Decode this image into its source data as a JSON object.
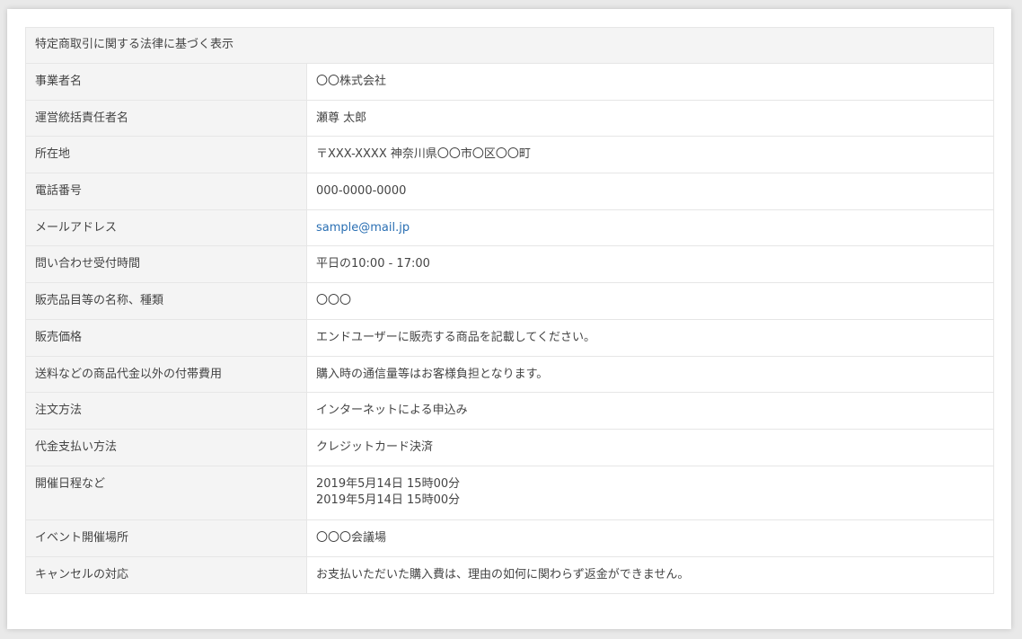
{
  "table": {
    "heading": "特定商取引に関する法律に基づく表示",
    "rows": [
      {
        "label": "事業者名",
        "value": "〇〇株式会社"
      },
      {
        "label": "運営統括責任者名",
        "value": "瀬尊 太郎"
      },
      {
        "label": "所在地",
        "value": "〒XXX-XXXX 神奈川県〇〇市〇区〇〇町"
      },
      {
        "label": "電話番号",
        "value": "000-0000-0000"
      },
      {
        "label": "メールアドレス",
        "value": "sample@mail.jp"
      },
      {
        "label": "問い合わせ受付時間",
        "value": "平日の10:00 - 17:00"
      },
      {
        "label": "販売品目等の名称、種類",
        "value": "〇〇〇"
      },
      {
        "label": "販売価格",
        "value": "エンドユーザーに販売する商品を記載してください。"
      },
      {
        "label": "送料などの商品代金以外の付帯費用",
        "value": "購入時の通信量等はお客様負担となります。"
      },
      {
        "label": "注文方法",
        "value": "インターネットによる申込み"
      },
      {
        "label": "代金支払い方法",
        "value": "クレジットカード決済"
      },
      {
        "label": "開催日程など",
        "value_lines": [
          "2019年5月14日 15時00分",
          "2019年5月14日 15時00分"
        ]
      },
      {
        "label": "イベント開催場所",
        "value": "〇〇〇会議場"
      },
      {
        "label": "キャンセルの対応",
        "value": "お支払いただいた購入費は、理由の如何に関わらず返金ができません。"
      }
    ]
  },
  "colors": {
    "link": "#2a6fb3",
    "header_bg": "#f4f4f4",
    "border": "#e6e6e6"
  }
}
